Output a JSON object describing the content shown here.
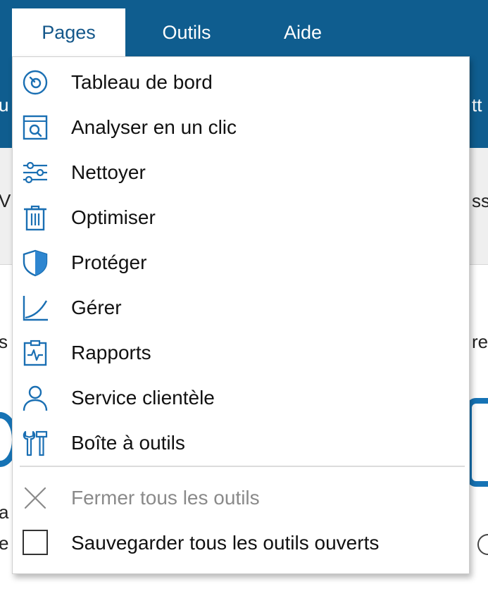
{
  "menubar": {
    "items": [
      {
        "label": "Pages",
        "active": true
      },
      {
        "label": "Outils",
        "active": false
      },
      {
        "label": "Aide",
        "active": false
      }
    ]
  },
  "background_fragments": {
    "left_1": "u",
    "right_1": "tt",
    "left_2": "V",
    "right_2": "ss",
    "left_3": "s",
    "right_3": "re",
    "left_4": "a",
    "left_5": "e"
  },
  "menu": {
    "items": [
      {
        "label": "Tableau de bord",
        "icon": "dashboard-icon"
      },
      {
        "label": "Analyser en un clic",
        "icon": "scan-icon"
      },
      {
        "label": "Nettoyer",
        "icon": "sliders-icon"
      },
      {
        "label": "Optimiser",
        "icon": "trash-icon"
      },
      {
        "label": "Protéger",
        "icon": "shield-icon"
      },
      {
        "label": "Gérer",
        "icon": "chart-curve-icon"
      },
      {
        "label": "Rapports",
        "icon": "report-clipboard-icon"
      },
      {
        "label": "Service clientèle",
        "icon": "person-icon"
      },
      {
        "label": "Boîte à outils",
        "icon": "toolbox-icon"
      }
    ],
    "close_all": {
      "label": "Fermer tous les outils",
      "enabled": false
    },
    "save_all": {
      "label": "Sauvegarder tous les outils ouverts",
      "checked": false
    }
  },
  "colors": {
    "menubar_bg": "#0f5d8f",
    "icon_blue": "#1a6fb3",
    "shield_fill": "#2e86d0",
    "disabled_text": "#8a8a8a"
  }
}
